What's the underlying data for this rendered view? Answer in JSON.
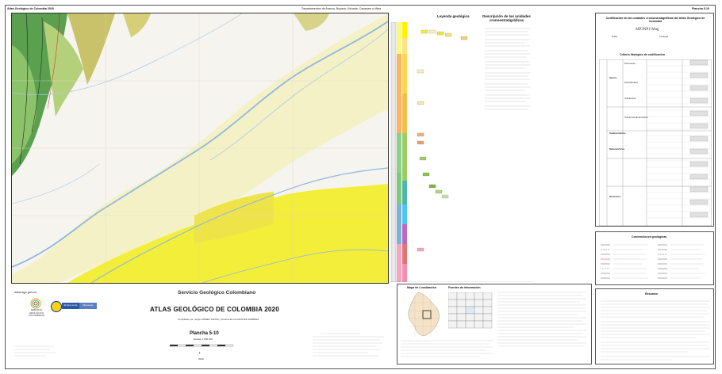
{
  "header": {
    "left_title": "Atlas Geológico de Colombia 2020",
    "center_title": "Departamentos de Arauca, Boyacá, Vichada, Casanare y Meta",
    "right_title": "Plancha 5-10"
  },
  "title_block": {
    "website": "www.sgc.gov.co",
    "agency": "Servicio Geológico Colombiano",
    "atlas_title": "ATLAS GEOLÓGICO DE COLOMBIA 2020",
    "compiled_by": "Compilado por: Jorge GÓMEZ TAPIAS y Nohora Emma MONTES RAMÍREZ",
    "sheet": "Plancha 5-10",
    "scale": "Escala: 1:500 000",
    "year": "2020",
    "logo_lines": [
      "SERVICIO",
      "GEOLÓGICO",
      "COLOMBIANO"
    ],
    "ministry": "El futuro es de todos",
    "ministry2": "Minenergía"
  },
  "legend": {
    "title": "Leyenda geológica",
    "units_title": "Descripción de las unidades cronoestratigráficas"
  },
  "classification": {
    "title": "Codificación de las unidades cronoestratigráficas del Atlas Geológico de Colombia",
    "example_code": "MP3NP1-Mag",
    "age_label": "Edad",
    "lith_label": "Litología",
    "criteria_title": "Criterio litológico de codificación",
    "groups": [
      "Ígneas",
      "Metamórficas",
      "Sedimentarias",
      "Depósitos"
    ],
    "sub": [
      "Plutónicas",
      "Hipoabisales",
      "Volcánicas",
      "Volcanosedimentarias"
    ]
  },
  "conventions": {
    "title": "Convenciones geológicas"
  },
  "location": {
    "title": "Mapa de Localización",
    "sources_title": "Fuentes de información"
  },
  "summary": {
    "title": "Resumen"
  },
  "colors": {
    "map_bg": "#f6f4ee",
    "yellow": "#f2ee3a",
    "pale_yellow": "#f7f2b8",
    "green": "#5aa04e",
    "olive": "#c9c26a",
    "river": "#8fb9df"
  }
}
